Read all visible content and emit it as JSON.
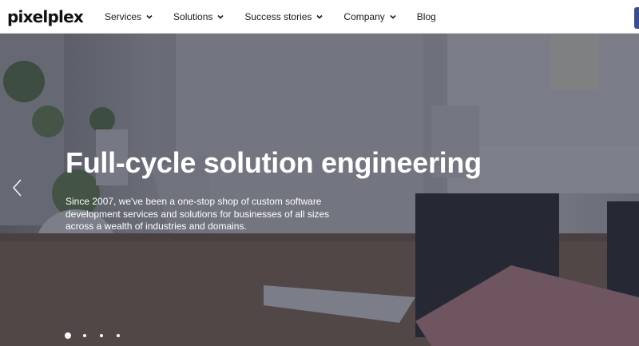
{
  "brand": {
    "logo_text": "pixelplex"
  },
  "nav": {
    "items": [
      {
        "label": "Services",
        "has_dropdown": true
      },
      {
        "label": "Solutions",
        "has_dropdown": true
      },
      {
        "label": "Success stories",
        "has_dropdown": true
      },
      {
        "label": "Company",
        "has_dropdown": true
      },
      {
        "label": "Blog",
        "has_dropdown": false
      }
    ]
  },
  "hero": {
    "title": "Full-cycle solution engineering",
    "description": "Since 2007, we've been a one-stop shop of custom software development services and solutions for businesses of all sizes across a wealth of industries and domains.",
    "background_image": "office-desk-with-monitor",
    "prev_arrow_icon": "chevron-left-icon"
  },
  "carousel": {
    "slide_count": 4,
    "active_index": 0
  },
  "colors": {
    "overlay": "#22283c",
    "text_on_hero": "#ffffff",
    "nav_text": "#1a1a1a",
    "header_accent": "#3b4d8f"
  }
}
